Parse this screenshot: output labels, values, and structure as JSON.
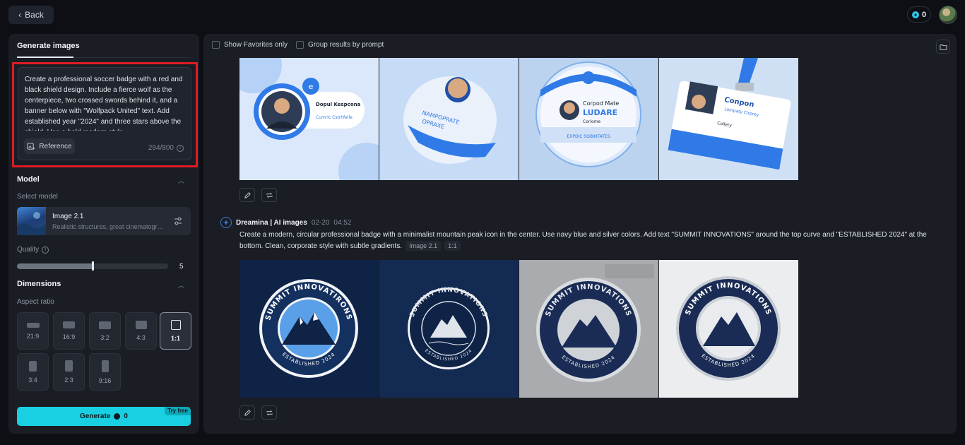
{
  "topbar": {
    "back_label": "Back",
    "credits": "0"
  },
  "left": {
    "tab_label": "Generate images",
    "prompt_text": "Create a professional soccer badge with a red and black shield design. Include a fierce wolf as the centerpiece, two crossed swords behind it, and a banner below with \"Wolfpack United\" text. Add established year \"2024\" and three stars above the shield. Use a bold modern style.",
    "reference_label": "Reference",
    "char_count": "294/800",
    "model_section": "Model",
    "select_model_label": "Select model",
    "model_name": "Image 2.1",
    "model_desc": "Realistic structures, great cinematography",
    "quality_label": "Quality",
    "quality_value": "5",
    "quality_fraction": 0.5,
    "dimensions_section": "Dimensions",
    "aspect_ratio_label": "Aspect ratio",
    "aspect_ratios": [
      "21:9",
      "16:9",
      "3:2",
      "4:3",
      "1:1",
      "3:4",
      "2:3",
      "9:16"
    ],
    "selected_ratio": "1:1",
    "generate_label": "Generate",
    "generate_cost": "0",
    "try_free_label": "Try free"
  },
  "right": {
    "show_favorites_label": "Show Favorites only",
    "group_by_prompt_label": "Group results by prompt",
    "group1_badges": [
      {
        "name": "Dopul Kespcona",
        "line": "Cumric Cstrhfelle"
      },
      {
        "line1": "NAMPOPRATE",
        "line2": "OPRAXE"
      },
      {
        "title": "Corpod Mate",
        "main": "LUDARE",
        "sub": "Corlome",
        "footer": "EXPDIC SOBINTATES"
      },
      {
        "company": "Conpon",
        "sub": "Lompaty Cirprey",
        "label": "Collety"
      }
    ],
    "group2": {
      "author": "Dreamina | AI images",
      "date": "02-20",
      "time": "04:52",
      "prompt": "Create a modern, circular professional badge with a minimalist mountain peak icon in the center. Use navy blue and silver colors. Add text \"SUMMIT INNOVATIONS\" around the top curve and \"ESTABLISHED 2024\" at the bottom. Clean, corporate style with subtle gradients.",
      "tags": [
        "Image 2.1",
        "1:1"
      ],
      "badges": [
        {
          "top": "SUMMIT INNOVATIRONS",
          "bottom": "ESTABLISHED 2024"
        },
        {
          "top": "SUMMIT INNOVATIONS",
          "bottom": "ESTABLISHED 2024"
        },
        {
          "top": "SUMMIT INNOVATIONS",
          "bottom": "ESTABLISHED 2024"
        },
        {
          "top": "SUMMIT INNOVATIONS",
          "bottom": "ESTABLISHED 2024"
        }
      ]
    }
  }
}
